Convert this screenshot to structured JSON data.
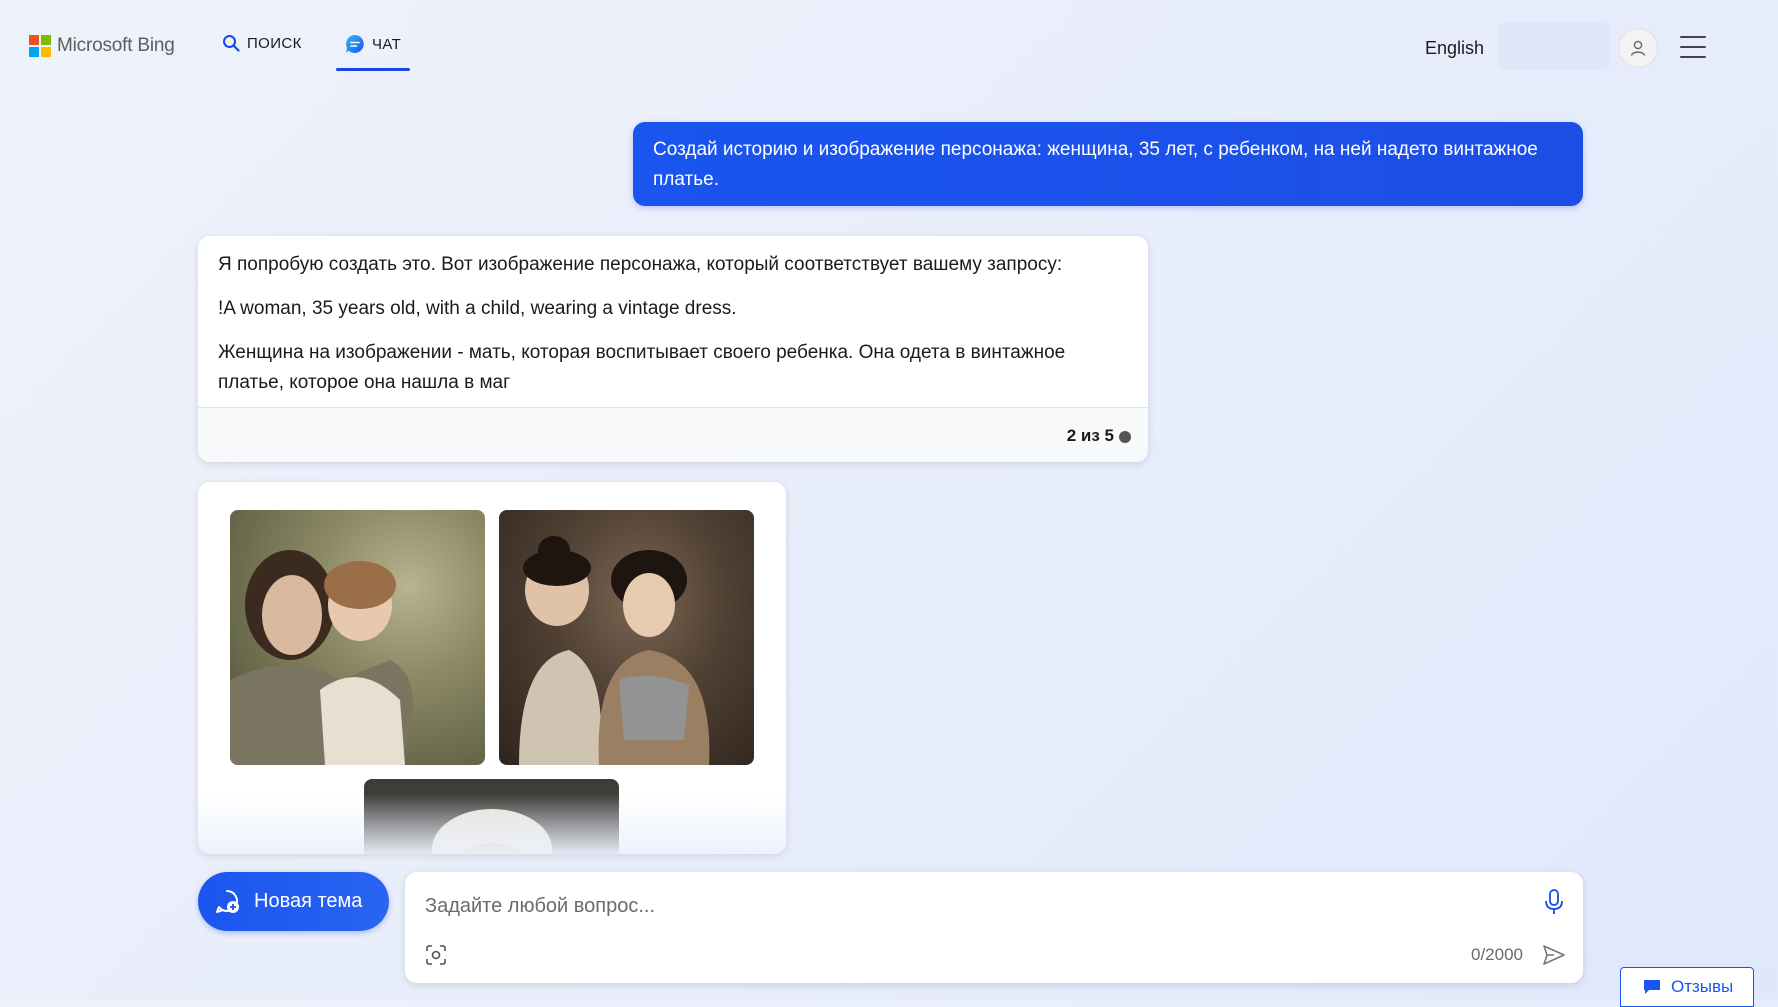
{
  "header": {
    "logo_text": "Microsoft Bing",
    "tabs": [
      {
        "label": "ПОИСК",
        "icon": "search-icon"
      },
      {
        "label": "ЧАТ",
        "icon": "chat-icon",
        "active": true
      }
    ],
    "language": "English",
    "avatar_icon": "user-icon",
    "menu_icon": "hamburger-menu-icon"
  },
  "conversation": {
    "user_message": "Создай историю и изображение персонажа: женщина, 35 лет, с ребенком, на ней надето винтажное платье.",
    "bot_message": {
      "paragraphs": [
        "Я попробую создать это. Вот изображение персонажа, который соответствует вашему запросу:",
        "!A woman, 35 years old, with a child, wearing a vintage dress.",
        "Женщина на изображении - мать, которая воспитывает своего ребенка. Она одета в винтажное платье, которое она нашла в маг"
      ],
      "response_counter": "2 из 5"
    },
    "generated_images": [
      {
        "subject": "woman-and-child-outdoor-vintage-photo"
      },
      {
        "subject": "asian-woman-and-child-vintage-photo"
      },
      {
        "subject": "woman-portrait-vintage-photo-partial"
      }
    ]
  },
  "composer": {
    "new_topic_label": "Новая тема",
    "placeholder": "Задайте любой вопрос...",
    "char_counter": "0/2000",
    "icons": [
      "microphone-icon",
      "visual-search-icon",
      "send-icon"
    ]
  },
  "feedback": {
    "label": "Отзывы"
  },
  "colors": {
    "accent": "#174ae4",
    "user_bubble": "#1a55ef",
    "background": "#e9eefb",
    "ms_red": "#f25022",
    "ms_green": "#7fba00",
    "ms_blue": "#00a4ef",
    "ms_yellow": "#ffb900"
  }
}
